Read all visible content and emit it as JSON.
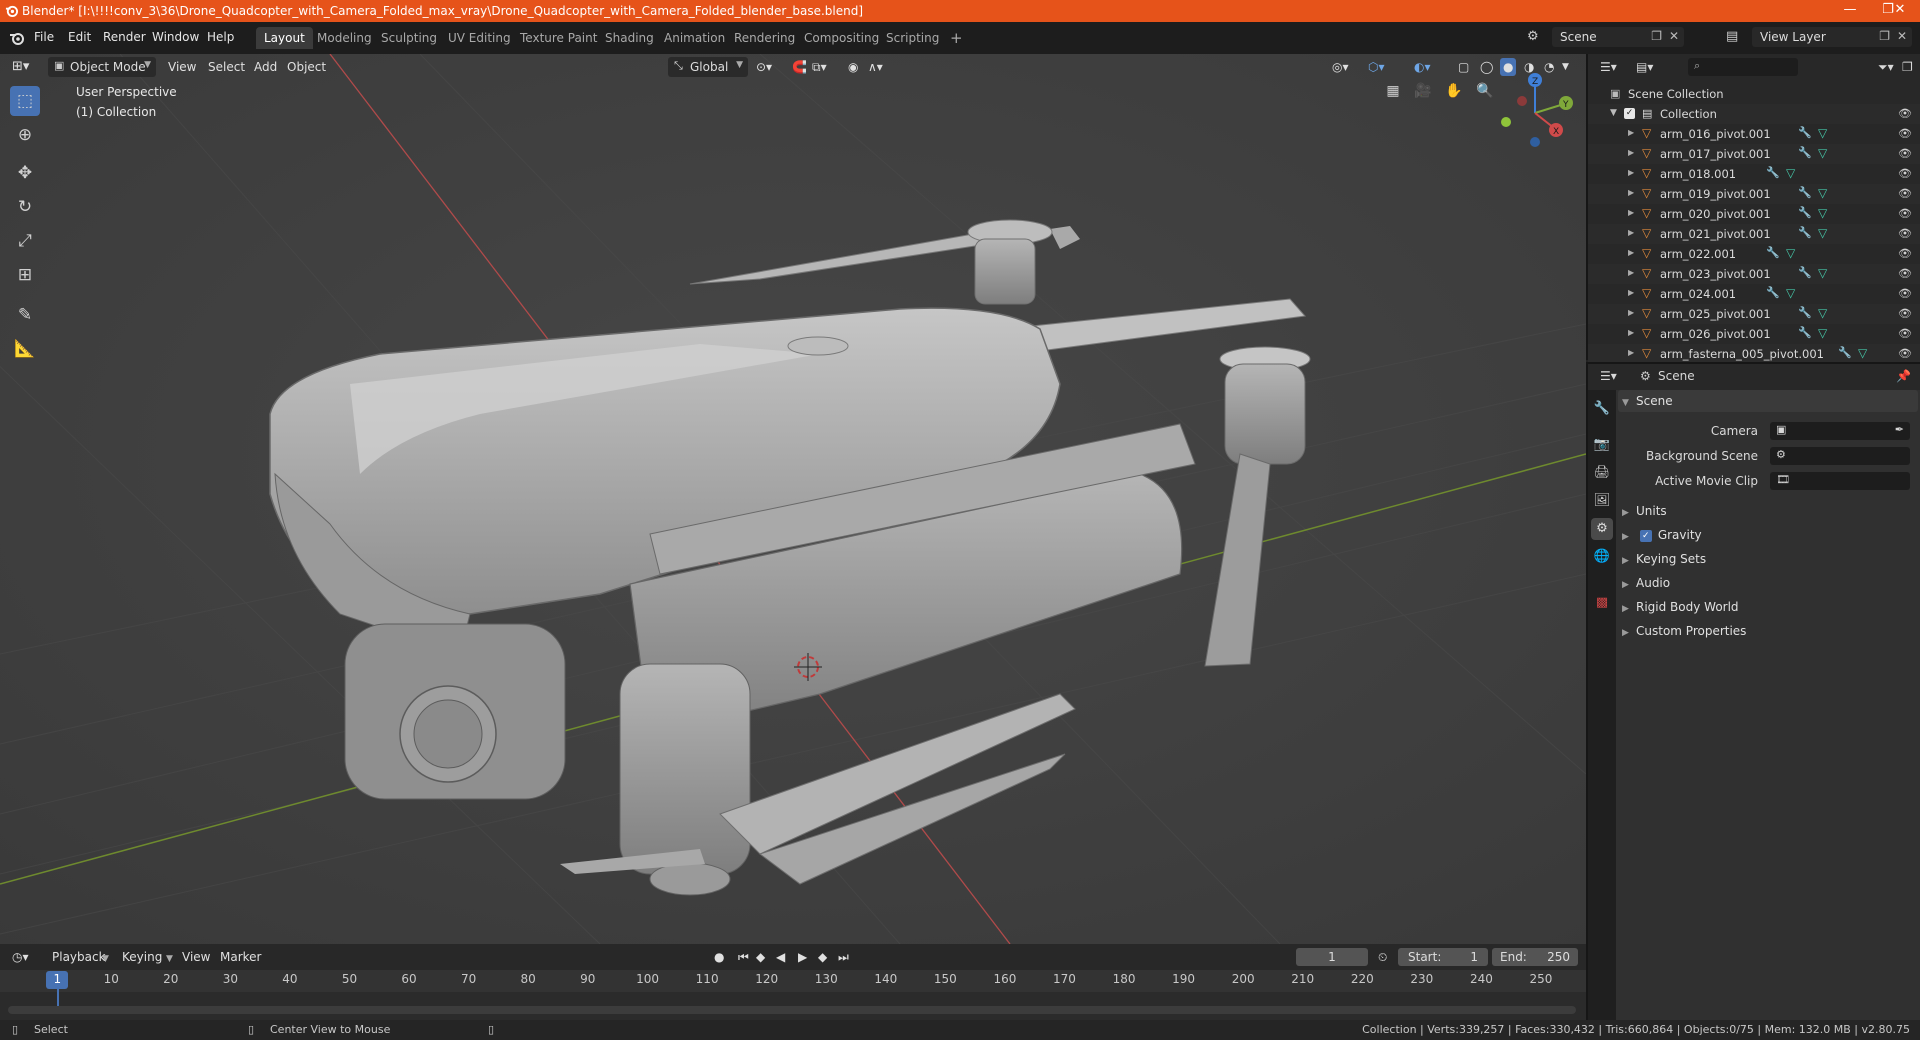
{
  "title_bar": {
    "text": "Blender* [I:\\!!!!conv_3\\36\\Drone_Quadcopter_with_Camera_Folded_max_vray\\Drone_Quadcopter_with_Camera_Folded_blender_base.blend]",
    "minimize": "—",
    "maximize": "❐",
    "close": "✕"
  },
  "menu": [
    "File",
    "Edit",
    "Render",
    "Window",
    "Help"
  ],
  "workspaces": [
    "Layout",
    "Modeling",
    "Sculpting",
    "UV Editing",
    "Texture Paint",
    "Shading",
    "Animation",
    "Rendering",
    "Compositing",
    "Scripting"
  ],
  "active_workspace": "Layout",
  "add_workspace": "+",
  "scene_selector": {
    "value": "Scene"
  },
  "view_layer_selector": {
    "value": "View Layer"
  },
  "viewport": {
    "mode": "Object Mode",
    "menus": [
      "View",
      "Select",
      "Add",
      "Object"
    ],
    "orientation": "Global",
    "perspective_label": "User Perspective",
    "collection_label": "(1) Collection",
    "gizmo": {
      "x": "X",
      "y": "Y",
      "z": "Z"
    }
  },
  "outliner": {
    "root": "Scene Collection",
    "collection": "Collection",
    "items": [
      "arm_016_pivot.001",
      "arm_017_pivot.001",
      "arm_018.001",
      "arm_019_pivot.001",
      "arm_020_pivot.001",
      "arm_021_pivot.001",
      "arm_022.001",
      "arm_023_pivot.001",
      "arm_024.001",
      "arm_025_pivot.001",
      "arm_026_pivot.001",
      "arm_fasterna_005_pivot.001"
    ]
  },
  "properties": {
    "header": "Scene",
    "section": "Scene",
    "fields": {
      "camera": "Camera",
      "background_scene": "Background Scene",
      "active_movie_clip": "Active Movie Clip"
    },
    "panels": [
      "Units",
      "Gravity",
      "Keying Sets",
      "Audio",
      "Rigid Body World",
      "Custom Properties"
    ],
    "gravity_checked": true
  },
  "timeline": {
    "menus": [
      "Playback",
      "Keying",
      "View",
      "Marker"
    ],
    "current_frame": "1",
    "start_label": "Start:",
    "start": "1",
    "end_label": "End:",
    "end": "250",
    "ticks": [
      "1",
      "10",
      "20",
      "30",
      "40",
      "50",
      "60",
      "70",
      "80",
      "90",
      "100",
      "110",
      "120",
      "130",
      "140",
      "150",
      "160",
      "170",
      "180",
      "190",
      "200",
      "210",
      "220",
      "230",
      "240",
      "250"
    ]
  },
  "status_bar": {
    "left_action": "Select",
    "middle_action": "Center View to Mouse",
    "stats": "Collection | Verts:339,257 | Faces:330,432 | Tris:660,864 | Objects:0/75 | Mem: 132.0 MB | v2.80.75"
  },
  "colors": {
    "title_bar": "#e6531a",
    "accent": "#4772b3",
    "object_icon": "#e08a3c",
    "mesh_icon": "#45c7a8",
    "x_axis": "#d04a4a",
    "y_axis": "#7fa83a",
    "z_axis": "#3f7fd8"
  }
}
